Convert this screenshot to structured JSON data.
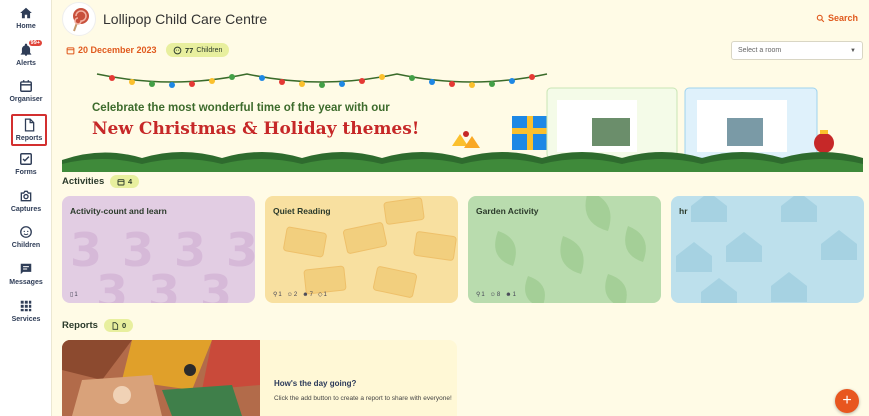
{
  "sidebar": {
    "items": [
      {
        "label": "Home",
        "icon": "home-icon"
      },
      {
        "label": "Alerts",
        "icon": "bell-icon",
        "badge": "99+"
      },
      {
        "label": "Organiser",
        "icon": "calendar-icon"
      },
      {
        "label": "Reports",
        "icon": "document-icon",
        "selected": true
      },
      {
        "label": "Forms",
        "icon": "checkbox-icon"
      },
      {
        "label": "Captures",
        "icon": "camera-icon"
      },
      {
        "label": "Children",
        "icon": "child-face-icon"
      },
      {
        "label": "Messages",
        "icon": "message-icon"
      },
      {
        "label": "Services",
        "icon": "grid-icon"
      }
    ]
  },
  "header": {
    "title": "Lollipop Child Care Centre",
    "search_label": "Search",
    "date": "20 December 2023",
    "children_count": "77",
    "children_label": "Children",
    "room_placeholder": "Select a room"
  },
  "banner": {
    "subtitle": "Celebrate the most wonderful time of the year with our",
    "headline": "New Christmas & Holiday themes!"
  },
  "activities": {
    "title": "Activities",
    "count": "4",
    "cards": [
      {
        "title": "Activity-count and learn",
        "color": "#e2cde3",
        "meta": [
          "1"
        ]
      },
      {
        "title": "Quiet Reading",
        "color": "#f8e0a0",
        "meta": [
          "1",
          "2",
          "7",
          "1"
        ]
      },
      {
        "title": "Garden Activity",
        "color": "#b9dcae",
        "meta": [
          "1",
          "8",
          "1"
        ]
      },
      {
        "title": "hr",
        "color": "#bde0ec",
        "meta": []
      }
    ]
  },
  "reports": {
    "title": "Reports",
    "count": "0",
    "empty_title": "How's the day going?",
    "empty_text": "Click the add button to create a report to share with everyone!"
  },
  "fab": {
    "label": "+"
  },
  "colors": {
    "accent": "#e05a1e",
    "badge": "#e0453a",
    "pill": "#e8ef9e",
    "background": "#fffbe6"
  }
}
